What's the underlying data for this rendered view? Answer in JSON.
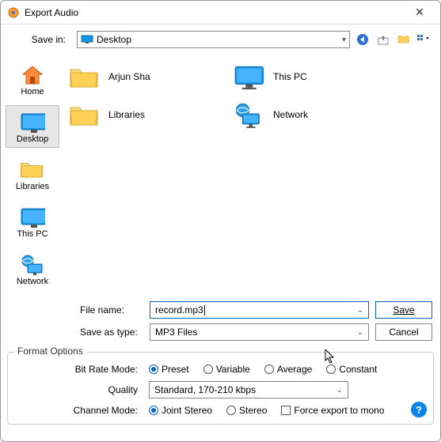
{
  "window": {
    "title": "Export Audio"
  },
  "save_in": {
    "label": "Save in:",
    "value": "Desktop"
  },
  "sidebar": {
    "items": [
      {
        "label": "Home"
      },
      {
        "label": "Desktop"
      },
      {
        "label": "Libraries"
      },
      {
        "label": "This PC"
      },
      {
        "label": "Network"
      }
    ],
    "selected_index": 1
  },
  "files": [
    {
      "name": "Arjun Sha",
      "kind": "folder"
    },
    {
      "name": "This PC",
      "kind": "computer"
    },
    {
      "name": "Libraries",
      "kind": "folder"
    },
    {
      "name": "Network",
      "kind": "network"
    }
  ],
  "file_name": {
    "label": "File name:",
    "value": "record.mp3"
  },
  "save_as_type": {
    "label": "Save as type:",
    "value": "MP3 Files"
  },
  "buttons": {
    "save": "Save",
    "cancel": "Cancel"
  },
  "format": {
    "legend": "Format Options",
    "bitrate": {
      "label": "Bit Rate Mode:",
      "options": [
        "Preset",
        "Variable",
        "Average",
        "Constant"
      ],
      "selected": "Preset"
    },
    "quality": {
      "label": "Quality",
      "value": "Standard, 170-210 kbps"
    },
    "channel": {
      "label": "Channel Mode:",
      "options": [
        "Joint Stereo",
        "Stereo"
      ],
      "selected": "Joint Stereo",
      "force_mono_label": "Force export to mono",
      "force_mono": false
    }
  },
  "icons": {
    "back": "back-icon",
    "up": "up-folder-icon",
    "new_folder": "new-folder-icon",
    "view": "view-menu-icon"
  }
}
